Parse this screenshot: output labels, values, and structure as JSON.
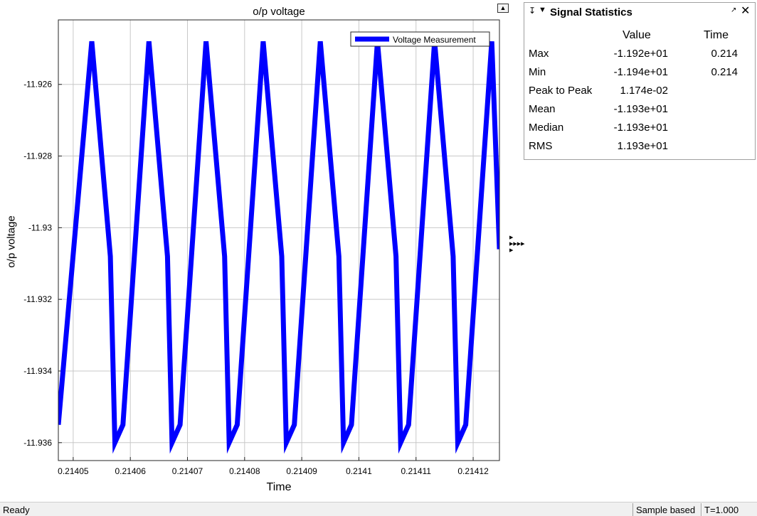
{
  "plot": {
    "title": "o/p voltage",
    "ylabel": "o/p voltage",
    "xlabel": "Time",
    "legend_label": "Voltage Measurement",
    "undock_icon": "undock-icon",
    "side_arrows_icon": "scroll-arrows-icon"
  },
  "chart_data": {
    "type": "line",
    "title": "o/p voltage",
    "xlabel": "Time",
    "ylabel": "o/p voltage",
    "xlim": [
      0.2140474,
      0.2141246
    ],
    "ylim": [
      -11.9365,
      -11.9242
    ],
    "xticks": [
      0.21405,
      0.21406,
      0.21407,
      0.21408,
      0.21409,
      0.2141,
      0.21411,
      0.21412
    ],
    "xtick_labels": [
      "0.21405",
      "0.21406",
      "0.21407",
      "0.21408",
      "0.21409",
      "0.2141",
      "0.21411",
      "0.21412"
    ],
    "yticks": [
      -11.936,
      -11.934,
      -11.932,
      -11.93,
      -11.928,
      -11.926
    ],
    "ytick_labels": [
      "-11.936",
      "-11.934",
      "-11.932",
      "-11.93",
      "-11.928",
      "-11.926"
    ],
    "grid": true,
    "legend_position": "top-right",
    "series": [
      {
        "name": "Voltage Measurement",
        "color": "#0000ff",
        "x": [
          0.2140474,
          0.21405325,
          0.2140565,
          0.2140573,
          0.2140587,
          0.21406325,
          0.2140665,
          0.2140673,
          0.2140687,
          0.21407325,
          0.2140765,
          0.2140773,
          0.2140787,
          0.21408325,
          0.2140865,
          0.2140873,
          0.2140887,
          0.21409325,
          0.2140965,
          0.2140973,
          0.2140987,
          0.21410325,
          0.2141065,
          0.2141073,
          0.2141087,
          0.21411325,
          0.2141165,
          0.2141173,
          0.2141187,
          0.21412325,
          0.2141246
        ],
        "y": [
          -11.9355,
          -11.9248,
          -11.9308,
          -11.936,
          -11.9355,
          -11.9248,
          -11.9308,
          -11.936,
          -11.9355,
          -11.9248,
          -11.9308,
          -11.936,
          -11.9355,
          -11.9248,
          -11.9308,
          -11.936,
          -11.9355,
          -11.9248,
          -11.9308,
          -11.936,
          -11.9355,
          -11.9248,
          -11.9308,
          -11.936,
          -11.9355,
          -11.9248,
          -11.9308,
          -11.936,
          -11.9355,
          -11.9248,
          -11.9306
        ]
      }
    ]
  },
  "stats": {
    "title": "Signal Statistics",
    "pin_icon": "pin-icon",
    "menu_icon": "panel-menu-icon",
    "restore_icon": "restore-icon",
    "close_icon": "close-icon",
    "col_value": "Value",
    "col_time": "Time",
    "rows": [
      {
        "label": "Max",
        "value": "-1.192e+01",
        "time": "0.214"
      },
      {
        "label": "Min",
        "value": "-1.194e+01",
        "time": "0.214"
      },
      {
        "label": "Peak to Peak",
        "value": "1.174e-02",
        "time": ""
      },
      {
        "label": "Mean",
        "value": "-1.193e+01",
        "time": ""
      },
      {
        "label": "Median",
        "value": "-1.193e+01",
        "time": ""
      },
      {
        "label": "RMS",
        "value": "1.193e+01",
        "time": ""
      }
    ]
  },
  "status": {
    "text": "Ready",
    "mode": "Sample based",
    "time": "T=1.000"
  }
}
